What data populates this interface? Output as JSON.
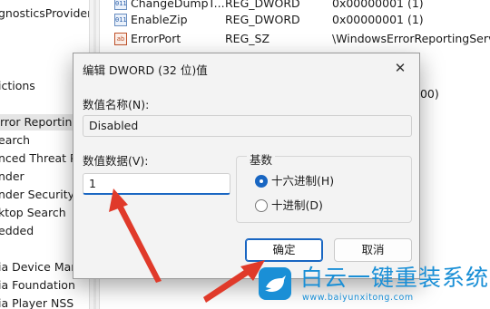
{
  "tree": {
    "items": [
      {
        "label": "gnosticsProvider"
      },
      {
        "label": "ictions"
      },
      {
        "label": "rror Reporting"
      },
      {
        "label": "earch"
      },
      {
        "label": "nced Threat P"
      },
      {
        "label": "nder"
      },
      {
        "label": "nder Security"
      },
      {
        "label": "ktop Search"
      },
      {
        "label": "edded"
      },
      {
        "label": "ia Device Man"
      },
      {
        "label": "ia Foundation"
      },
      {
        "label": "ia Player NSS"
      }
    ]
  },
  "values": {
    "rows": [
      {
        "icon": "binary-value-icon",
        "name": "ChangeDumpT...",
        "type": "REG_DWORD",
        "data": "0x00000001 (1)"
      },
      {
        "icon": "binary-value-icon",
        "name": "EnableZip",
        "type": "REG_DWORD",
        "data": "0x00000001 (1)"
      },
      {
        "icon": "string-value-icon",
        "name": "ErrorPort",
        "type": "REG_SZ",
        "data": "\\WindowsErrorReportingServ"
      }
    ],
    "partial_data": "000)"
  },
  "dialog": {
    "title": "编辑 DWORD (32 位)值",
    "close_icon": "close-icon",
    "name_label": "数值名称(N):",
    "name_value": "Disabled",
    "data_label": "数值数据(V):",
    "data_value": "1",
    "base_label": "基数",
    "radios": [
      {
        "label": "十六进制(H)",
        "checked": true
      },
      {
        "label": "十进制(D)",
        "checked": false
      }
    ],
    "ok_label": "确定",
    "cancel_label": "取消"
  },
  "watermark": {
    "text": "白云一键重装系统",
    "url": "www.baiyunxitong.com",
    "icon": "bird-icon",
    "color": "#1a8fd6"
  },
  "colors": {
    "accent": "#1966c2",
    "arrow": "#e03a2a"
  }
}
